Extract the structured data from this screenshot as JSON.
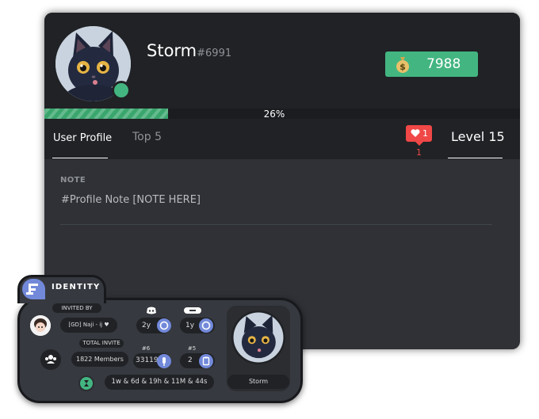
{
  "profile": {
    "username": "Storm",
    "discriminator": "#6991",
    "status_color": "#43b581"
  },
  "coins": {
    "value": "7988",
    "icon": "money-bag-icon"
  },
  "xp": {
    "percent_label": "26%",
    "progress": 0.26
  },
  "tabs": [
    {
      "label": "User Profile",
      "active": true
    },
    {
      "label": "Top 5",
      "active": false
    }
  ],
  "reputation": {
    "badge_count": "1",
    "count": "1",
    "icon": "heart-icon"
  },
  "level": {
    "label": "Level 15"
  },
  "note": {
    "label": "NOTE",
    "text": "#Profile Note [NOTE HERE]"
  },
  "identity": {
    "title": "IDENTITY",
    "invited_by_label": "INVITED BY",
    "invited_by_value": "[GD] Naji - ij ♥",
    "total_invite_label": "TOTAL INVITE",
    "total_invite_value": "1822 Members",
    "discord_age": "2y",
    "server_age": "1y",
    "msg_rank": "#6",
    "msg_count": "33119",
    "voice_rank": "#5",
    "voice_count": "2",
    "voice_time": "1w & 6d & 19h & 11M & 44s",
    "avatar_name": "Storm"
  },
  "colors": {
    "card_bg": "#2f3136",
    "header_bg": "#202225",
    "accent_green": "#43b581",
    "blurple": "#7289da",
    "rep_red": "#f04747"
  }
}
